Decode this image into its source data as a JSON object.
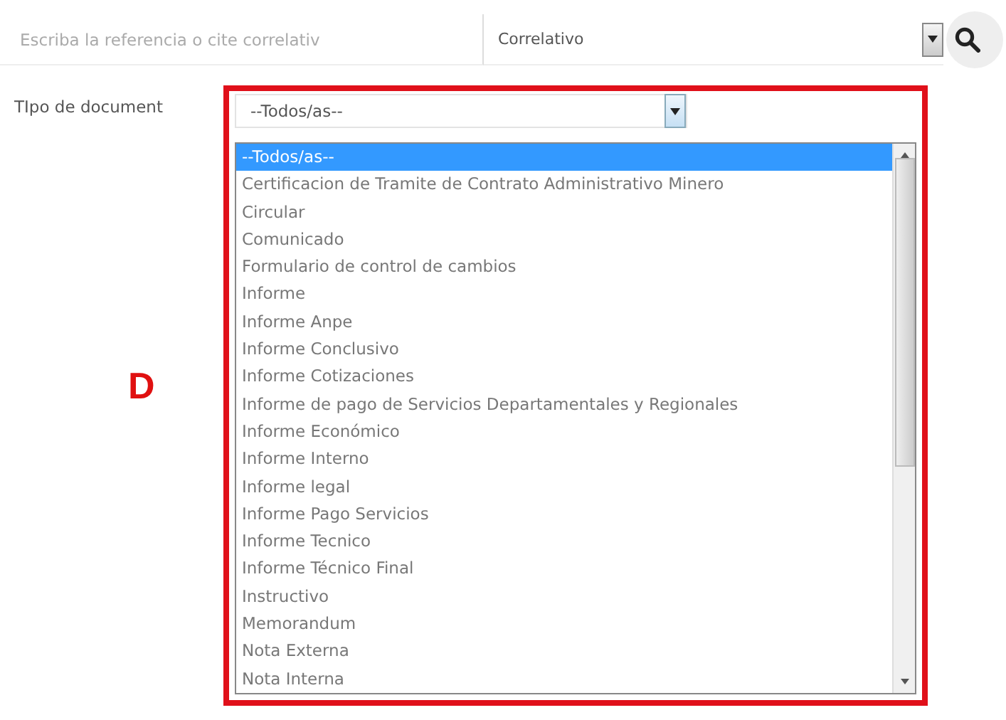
{
  "search": {
    "placeholder": "Escriba la referencia o cite correlativ"
  },
  "search_by": {
    "value": "Correlativo"
  },
  "filter": {
    "label": "TIpo de document",
    "value": "--Todos/as--"
  },
  "annotation": "D",
  "options": [
    {
      "label": "--Todos/as--",
      "selected": true
    },
    {
      "label": "Certificacion de Tramite de Contrato Administrativo Minero",
      "selected": false
    },
    {
      "label": "Circular",
      "selected": false
    },
    {
      "label": "Comunicado",
      "selected": false
    },
    {
      "label": "Formulario de control de cambios",
      "selected": false
    },
    {
      "label": "Informe",
      "selected": false
    },
    {
      "label": "Informe Anpe",
      "selected": false
    },
    {
      "label": "Informe Conclusivo",
      "selected": false
    },
    {
      "label": "Informe Cotizaciones",
      "selected": false
    },
    {
      "label": "Informe de pago de Servicios Departamentales y Regionales",
      "selected": false
    },
    {
      "label": "Informe Económico",
      "selected": false
    },
    {
      "label": "Informe Interno",
      "selected": false
    },
    {
      "label": "Informe legal",
      "selected": false
    },
    {
      "label": "Informe Pago Servicios",
      "selected": false
    },
    {
      "label": "Informe Tecnico",
      "selected": false
    },
    {
      "label": "Informe Técnico Final",
      "selected": false
    },
    {
      "label": "Instructivo",
      "selected": false
    },
    {
      "label": "Memorandum",
      "selected": false
    },
    {
      "label": "Nota Externa",
      "selected": false
    },
    {
      "label": "Nota Interna",
      "selected": false
    }
  ]
}
